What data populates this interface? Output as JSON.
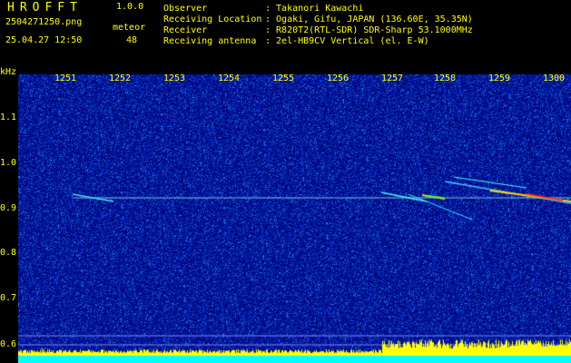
{
  "header": {
    "app_name": "HROFFT",
    "version": "1.0.0",
    "filename": "2504271250.png",
    "meteor_label": "meteor",
    "datetime": "25.04.27 12:50",
    "meteor_count": "48"
  },
  "info": [
    {
      "label": "Observer",
      "value": ": Takanori Kawachi"
    },
    {
      "label": "Receiving Location",
      "value": ": Ogaki, Gifu, JAPAN (136.60E, 35.35N)"
    },
    {
      "label": "Receiver",
      "value": ": R820T2(RTL-SDR) SDR-Sharp 53.1000MHz"
    },
    {
      "label": "Receiving antenna",
      "value": ": 2el-HB9CV Vertical (el. E-W)"
    }
  ],
  "axes": {
    "y_unit": "kHz",
    "x_ticks": [
      "1251",
      "1252",
      "1253",
      "1254",
      "1255",
      "1256",
      "1257",
      "1258",
      "1259",
      "1300"
    ],
    "y_ticks": [
      "1.1",
      "1.0",
      "0.9",
      "0.8",
      "0.7",
      "0.6"
    ]
  },
  "colors": {
    "header_text": "#ffff00",
    "info_text": "#00ffff",
    "noise_bg": "#000b8a",
    "carrier": "#9fe6ff",
    "meteor_hot": "#ff3020",
    "meteor_warm": "#ffd000",
    "level_fill": "#ffff00",
    "baseline": "#00ffff"
  }
}
